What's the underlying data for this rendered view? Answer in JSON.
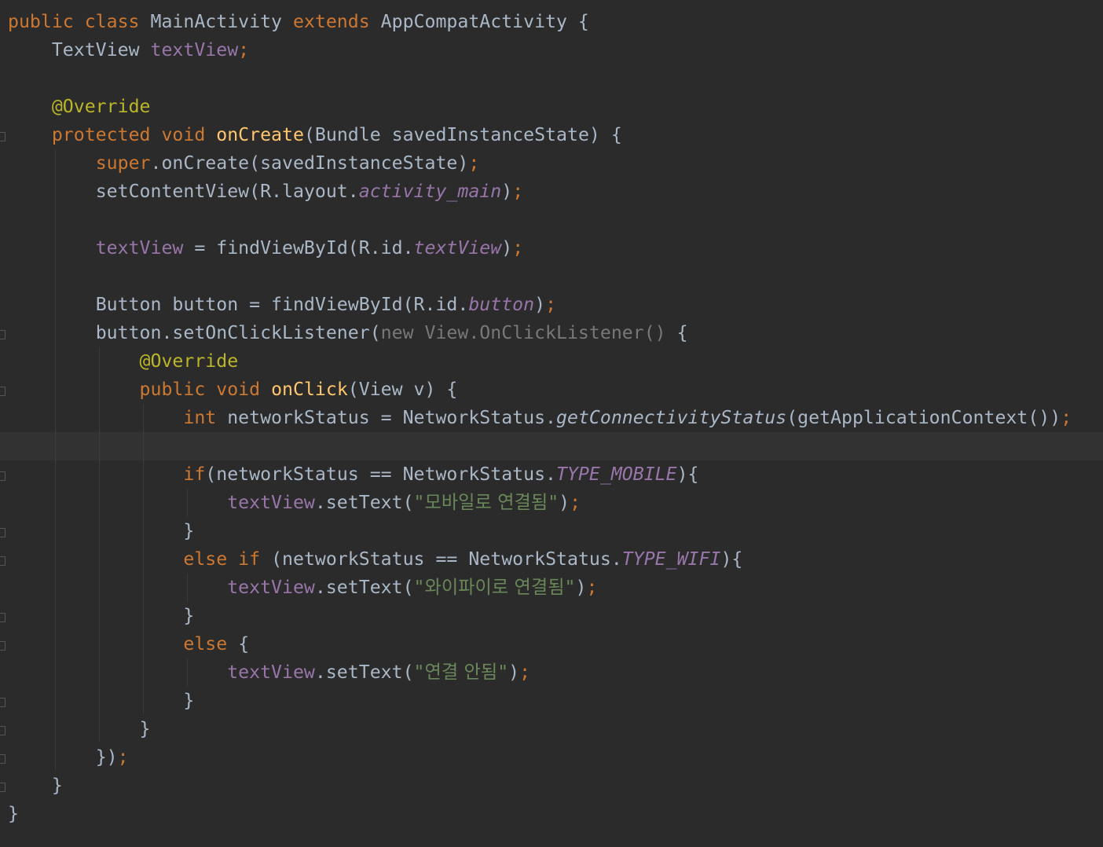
{
  "colors": {
    "background": "#2b2b2b",
    "caret_row": "#323232",
    "keyword": "#cc7832",
    "annotation": "#bbb529",
    "method_declaration": "#ffc66d",
    "field": "#9876aa",
    "string": "#6a8759",
    "plain": "#a9b7c6",
    "folded_anonymous": "#787878"
  },
  "code": {
    "l1": {
      "t1": "public class ",
      "t2": "MainActivity ",
      "t3": "extends ",
      "t4": "AppCompatActivity {"
    },
    "l2": {
      "t1": "TextView ",
      "t2": "textView",
      "t3": ";"
    },
    "l4": {
      "t1": "@Override"
    },
    "l5": {
      "t1": "protected void ",
      "t2": "onCreate",
      "t3": "(Bundle savedInstanceState) {"
    },
    "l6": {
      "t1": "super",
      "t2": ".onCreate(savedInstanceState)",
      "t3": ";"
    },
    "l7": {
      "t1": "setContentView(R.layout.",
      "t2": "activity_main",
      "t3": ")",
      "t4": ";"
    },
    "l9": {
      "t1": "textView",
      "t2": " = findViewById(R.id.",
      "t3": "textView",
      "t4": ")",
      "t5": ";"
    },
    "l11": {
      "t1": "Button button = findViewById(R.id.",
      "t2": "button",
      "t3": ")",
      "t4": ";"
    },
    "l12": {
      "t1": "button.setOnClickListener(",
      "t2": "new View.OnClickListener()",
      "t3": " {"
    },
    "l13": {
      "t1": "@Override"
    },
    "l14": {
      "t1": "public void ",
      "t2": "onClick",
      "t3": "(View v) {"
    },
    "l15": {
      "t1": "int ",
      "t2": "networkStatus = NetworkStatus.",
      "t3": "getConnectivityStatus",
      "t4": "(getApplicationContext())",
      "t5": ";"
    },
    "l17": {
      "t1": "if",
      "t2": "(networkStatus == NetworkStatus.",
      "t3": "TYPE_MOBILE",
      "t4": "){"
    },
    "l18": {
      "t1": "textView",
      "t2": ".setText(",
      "t3": "\"",
      "t4": "모바일로 연결됨",
      "t5": "\"",
      "t6": ")",
      "t7": ";"
    },
    "l19": {
      "t1": "}"
    },
    "l20": {
      "t1": "else if ",
      "t2": "(networkStatus == NetworkStatus.",
      "t3": "TYPE_WIFI",
      "t4": "){"
    },
    "l21": {
      "t1": "textView",
      "t2": ".setText(",
      "t3": "\"",
      "t4": "와이파이로 연결됨",
      "t5": "\"",
      "t6": ")",
      "t7": ";"
    },
    "l22": {
      "t1": "}"
    },
    "l23": {
      "t1": "else ",
      "t2": "{"
    },
    "l24": {
      "t1": "textView",
      "t2": ".setText(",
      "t3": "\"",
      "t4": "연결 안됨",
      "t5": "\"",
      "t6": ")",
      "t7": ";"
    },
    "l25": {
      "t1": "}"
    },
    "l26": {
      "t1": "}"
    },
    "l27": {
      "t1": "})",
      "t2": ";"
    },
    "l28": {
      "t1": "}"
    },
    "l29": {
      "t1": "}"
    }
  }
}
